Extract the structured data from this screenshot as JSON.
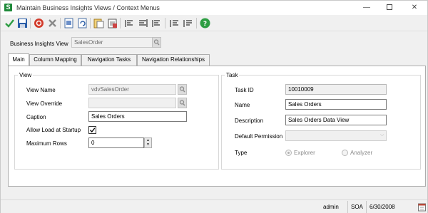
{
  "window": {
    "title": "Maintain Business Insights Views / Context Menus",
    "app_icon": "S"
  },
  "toolbar": {
    "icons": [
      "accept-check-icon",
      "save-icon",
      "cancel-icon",
      "delete-icon",
      "view-icon",
      "refresh-icon",
      "copy-icon",
      "paste-icon",
      "align-left-icon",
      "align-center-icon",
      "align-right-icon",
      "indent-icon",
      "outdent-icon",
      "help-icon"
    ]
  },
  "business_insights_view": {
    "label": "Business Insights View",
    "value": "SalesOrder"
  },
  "tabs": [
    {
      "label": "Main",
      "active": true
    },
    {
      "label": "Column Mapping",
      "active": false
    },
    {
      "label": "Navigation Tasks",
      "active": false
    },
    {
      "label": "Navigation Relationships",
      "active": false
    }
  ],
  "view_group": {
    "title": "View",
    "view_name_label": "View Name",
    "view_name_value": "vdvSalesOrder",
    "view_override_label": "View Override",
    "view_override_value": "",
    "caption_label": "Caption",
    "caption_value": "Sales Orders",
    "allow_load_label": "Allow Load at Startup",
    "allow_load_checked": true,
    "max_rows_label": "Maximum Rows",
    "max_rows_value": "0"
  },
  "task_group": {
    "title": "Task",
    "task_id_label": "Task ID",
    "task_id_value": "10010009",
    "name_label": "Name",
    "name_value": "Sales Orders",
    "description_label": "Description",
    "description_value": "Sales Orders Data View",
    "default_permission_label": "Default Permission",
    "default_permission_value": "",
    "type_label": "Type",
    "type_options": [
      {
        "label": "Explorer",
        "selected": true
      },
      {
        "label": "Analyzer",
        "selected": false
      }
    ]
  },
  "statusbar": {
    "user": "admin",
    "company": "SOA",
    "date": "6/30/2008"
  },
  "colors": {
    "app_icon_bg": "#1f8a3a",
    "help_icon": "#2e9e43",
    "cancel_icon": "#d23a2a"
  }
}
